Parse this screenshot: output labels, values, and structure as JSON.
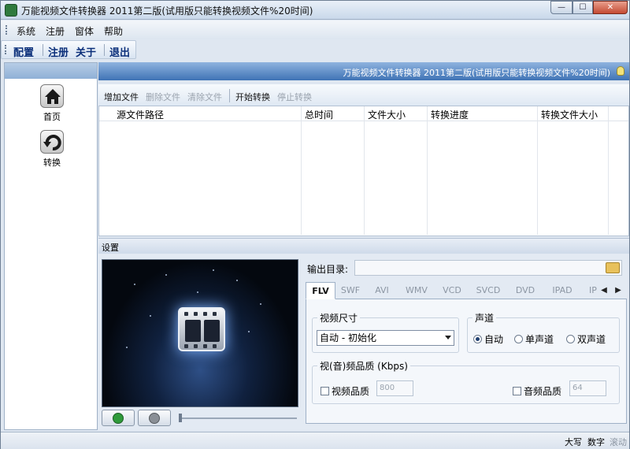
{
  "window": {
    "title": "万能视频文件转换器 2011第二版(试用版只能转换视频文件%20时间)",
    "min": "—",
    "max": "☐",
    "close": "✕"
  },
  "menu": [
    "系统",
    "注册",
    "窗体",
    "帮助"
  ],
  "toolbar": {
    "config": "配置",
    "register": "注册",
    "about": "关于",
    "exit": "退出"
  },
  "sidebar": {
    "items": [
      {
        "label": "首页",
        "icon": "home-icon"
      },
      {
        "label": "转换",
        "icon": "convert-icon"
      }
    ]
  },
  "banner": "万能视频文件转换器 2011第二版(试用版只能转换视频文件%20时间)",
  "file_toolbar": {
    "add": "增加文件",
    "remove": "删除文件",
    "clear": "清除文件",
    "start": "开始转换",
    "stop": "停止转换"
  },
  "table": {
    "columns": [
      "源文件路径",
      "总时间",
      "文件大小",
      "转换进度",
      "转换文件大小"
    ]
  },
  "settings": {
    "header": "设置",
    "output_label": "输出目录:",
    "output_value": "",
    "tabs": [
      "FLV",
      "SWF",
      "AVI",
      "WMV",
      "VCD",
      "SVCD",
      "DVD",
      "IPAD",
      "IP"
    ],
    "active_tab": "FLV",
    "video_size": {
      "label": "视频尺寸",
      "value": "自动 - 初始化"
    },
    "channel": {
      "label": "声道",
      "options": [
        "自动",
        "单声道",
        "双声道"
      ],
      "selected": "自动"
    },
    "quality": {
      "label": "视(音)频品质 (Kbps)",
      "video_label": "视频品质",
      "video_value": "800",
      "audio_label": "音频品质",
      "audio_value": "64"
    }
  },
  "statusbar": {
    "caps": "大写",
    "num": "数字",
    "scroll": "滚动"
  }
}
